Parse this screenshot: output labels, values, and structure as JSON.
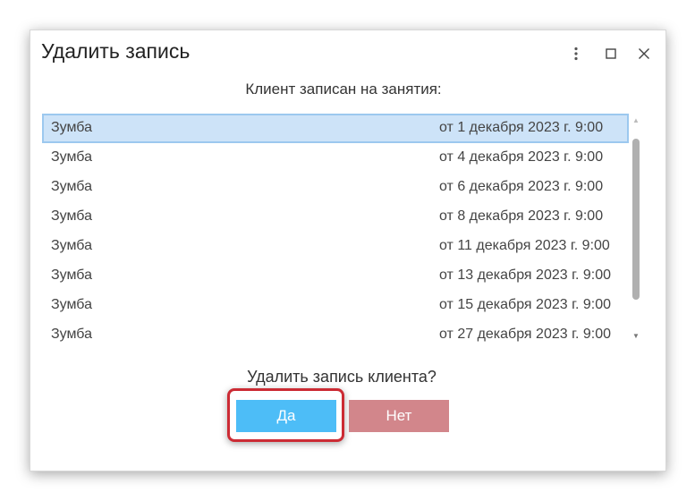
{
  "dialog": {
    "title": "Удалить запись",
    "subtitle": "Клиент записан на занятия:",
    "controls": {
      "more_icon": "more-vertical-icon",
      "maximize_icon": "maximize-icon",
      "close_icon": "close-icon"
    },
    "entries": [
      {
        "name": "Зумба",
        "date": "от 1 декабря 2023 г. 9:00",
        "selected": true
      },
      {
        "name": "Зумба",
        "date": "от 4 декабря 2023 г. 9:00"
      },
      {
        "name": "Зумба",
        "date": "от 6 декабря 2023 г. 9:00"
      },
      {
        "name": "Зумба",
        "date": "от 8 декабря 2023 г. 9:00"
      },
      {
        "name": "Зумба",
        "date": "от 11 декабря 2023 г. 9:00"
      },
      {
        "name": "Зумба",
        "date": "от 13 декабря 2023 г. 9:00"
      },
      {
        "name": "Зумба",
        "date": "от 15 декабря 2023 г. 9:00"
      },
      {
        "name": "Зумба",
        "date": "от 27 декабря 2023 г. 9:00"
      }
    ],
    "question": "Удалить запись клиента?",
    "buttons": {
      "yes": "Да",
      "no": "Нет"
    },
    "colors": {
      "yes_button": "#4dbdf7",
      "no_button": "#d2868b",
      "highlight": "#cc2b34",
      "selected_row": "#cde3f8"
    }
  }
}
